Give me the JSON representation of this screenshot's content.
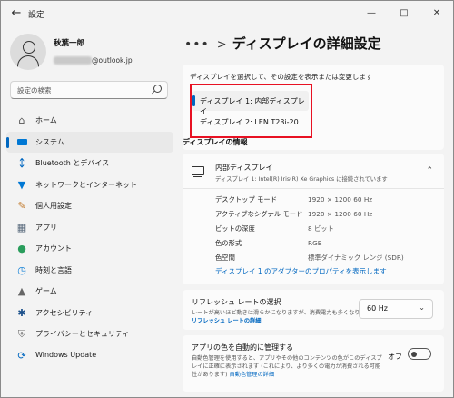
{
  "window": {
    "title": "設定"
  },
  "profile": {
    "name": "秋葉一郎",
    "email_domain": "@outlook.jp"
  },
  "search": {
    "placeholder": "設定の検索"
  },
  "sidebar": {
    "items": [
      {
        "label": "ホーム",
        "icon": "home-icon"
      },
      {
        "label": "システム",
        "icon": "system-icon",
        "active": true
      },
      {
        "label": "Bluetooth とデバイス",
        "icon": "bluetooth-icon"
      },
      {
        "label": "ネットワークとインターネット",
        "icon": "network-icon"
      },
      {
        "label": "個人用設定",
        "icon": "personalization-icon"
      },
      {
        "label": "アプリ",
        "icon": "apps-icon"
      },
      {
        "label": "アカウント",
        "icon": "account-icon"
      },
      {
        "label": "時刻と言語",
        "icon": "time-language-icon"
      },
      {
        "label": "ゲーム",
        "icon": "gaming-icon"
      },
      {
        "label": "アクセシビリティ",
        "icon": "accessibility-icon"
      },
      {
        "label": "プライバシーとセキュリティ",
        "icon": "privacy-icon"
      },
      {
        "label": "Windows Update",
        "icon": "windows-update-icon"
      }
    ]
  },
  "breadcrumb": {
    "dots": "•••",
    "separator": ">",
    "title": "ディスプレイの詳細設定"
  },
  "display_select": {
    "hint": "ディスプレイを選択して、その設定を表示または変更します",
    "options": [
      {
        "label": "ディスプレイ 1: 内部ディスプレイ",
        "selected": true
      },
      {
        "label": "ディスプレイ 2: LEN T23i-20",
        "selected": false
      }
    ]
  },
  "display_info": {
    "section_title": "ディスプレイの情報",
    "name": "内部ディスプレイ",
    "subtitle": "ディスプレイ 1: Intel(R) Iris(R) Xe Graphics に接続されています",
    "specs": [
      {
        "label": "デスクトップ モード",
        "value": "1920 × 1200 60 Hz"
      },
      {
        "label": "アクティブなシグナル モード",
        "value": "1920 × 1200 60 Hz"
      },
      {
        "label": "ビットの深度",
        "value": "8 ビット"
      },
      {
        "label": "色の形式",
        "value": "RGB"
      },
      {
        "label": "色空間",
        "value": "標準ダイナミック レンジ (SDR)"
      }
    ],
    "adapter_link": "ディスプレイ 1 のアダプターのプロパティを表示します"
  },
  "refresh": {
    "title": "リフレッシュ レートの選択",
    "desc": "レートが高いほど動きは滑らかになりますが、消費電力も多くなります",
    "link": "リフレッシュ レートの詳細",
    "value": "60 Hz"
  },
  "auto_color": {
    "title": "アプリの色を自動的に管理する",
    "desc1": "自動色管理を使用すると、アプリやその他のコンテンツの色がこのディスプ",
    "desc2": "レイに正確に表示されます (これにより、より多くの電力が消費される可能",
    "desc3": "性があります)",
    "link": "自動色管理の詳細",
    "toggle_label": "オフ"
  },
  "colors": {
    "accent": "#0067c0",
    "highlight": "#e81123"
  }
}
